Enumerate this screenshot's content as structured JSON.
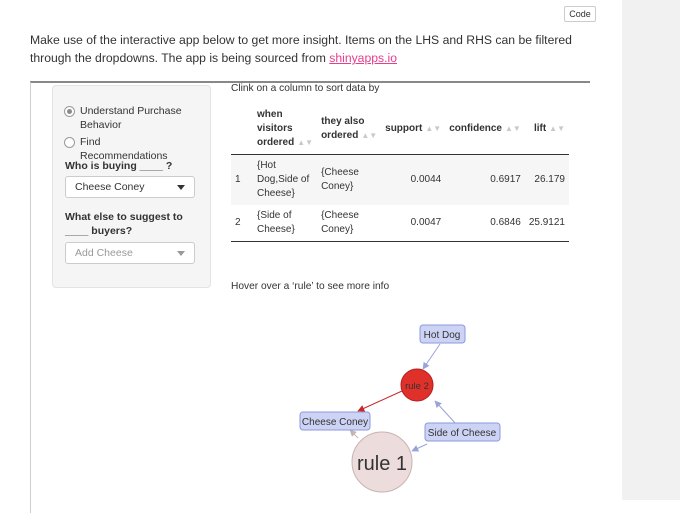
{
  "code_button": "Code",
  "intro": {
    "text": "Make use of the interactive app below to get more insight. Items on the LHS and RHS can be filtered through the dropdowns. The app is being sourced from ",
    "link": "shinyapps.io"
  },
  "sidebar": {
    "radio_options": [
      {
        "label": "Understand Purchase Behavior",
        "checked": true
      },
      {
        "label": "Find Recommendations",
        "checked": false
      }
    ],
    "who_label": "Who is buying ____ ?",
    "who_value": "Cheese Coney",
    "suggest_label": "What else to suggest to ____ buyers?",
    "suggest_placeholder": "Add Cheese"
  },
  "table": {
    "caption": "Clink on a column to sort data by",
    "columns": [
      "",
      "when visitors ordered",
      "they also ordered",
      "support",
      "confidence",
      "lift"
    ],
    "rows": [
      {
        "index": "1",
        "lhs": "{Hot Dog,Side of Cheese}",
        "rhs": "{Cheese Coney}",
        "support": "0.0044",
        "confidence": "0.6917",
        "lift": "26.179"
      },
      {
        "index": "2",
        "lhs": "{Side of Cheese}",
        "rhs": "{Cheese Coney}",
        "support": "0.0047",
        "confidence": "0.6846",
        "lift": "25.9121"
      }
    ]
  },
  "hover_hint": "Hover over a ‘rule’ to see more info",
  "network": {
    "nodes": {
      "hot_dog": "Hot Dog",
      "rule2": "rule 2",
      "cheese_coney": "Cheese Coney",
      "side_of_cheese": "Side of Cheese",
      "rule1": "rule 1"
    },
    "colors": {
      "item_fill": "#cdd3f4",
      "item_stroke": "#8d98dc",
      "rule2_fill": "#e0302a",
      "rule1_fill": "#ecdcdc",
      "red_edge": "#c8282a",
      "blue_edge": "#98a3d8",
      "pink_edge": "#c8b3b3"
    }
  }
}
